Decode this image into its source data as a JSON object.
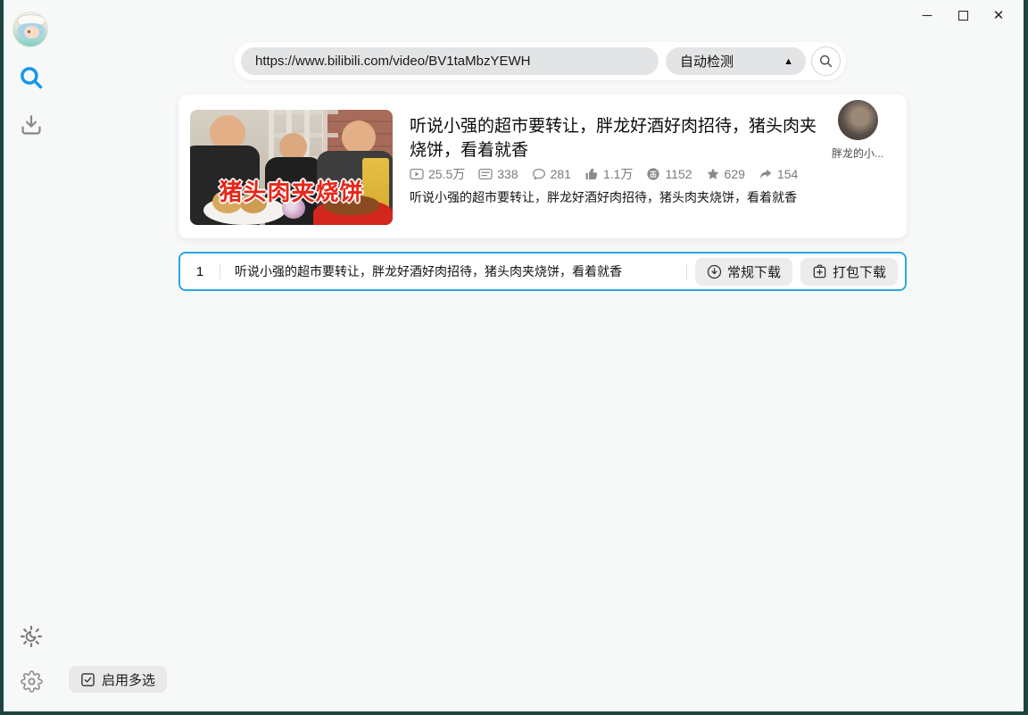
{
  "window": {
    "controls": {
      "minimize": "─",
      "close": "✕"
    }
  },
  "topbar": {
    "url_value": "https://www.bilibili.com/video/BV1taMbzYEWH",
    "mode_selected": "自动检测",
    "mode_arrow": "▲"
  },
  "video_card": {
    "title": "听说小强的超市要转让，胖龙好酒好肉招待，猪头肉夹烧饼，看着就香",
    "thumbnail_caption": "猪头肉夹烧饼",
    "stats": {
      "views": "25.5万",
      "danmaku": "338",
      "comments": "281",
      "likes": "1.1万",
      "coins": "1152",
      "favorites": "629",
      "shares": "154"
    },
    "description": "听说小强的超市要转让，胖龙好酒好肉招待，猪头肉夹烧饼，看着就香",
    "uploader_name": "胖龙的小..."
  },
  "selection_row": {
    "index": "1",
    "title": "听说小强的超市要转让，胖龙好酒好肉招待，猪头肉夹烧饼，看着就香",
    "regular_download_label": "常规下载",
    "package_download_label": "打包下载"
  },
  "footer": {
    "multi_select_label": "启用多选"
  },
  "colors": {
    "accent_blue": "#1d9bf0",
    "selection_border": "#2aa7e3",
    "frame": "#1c4540",
    "app_background": "#f7f8f8"
  }
}
